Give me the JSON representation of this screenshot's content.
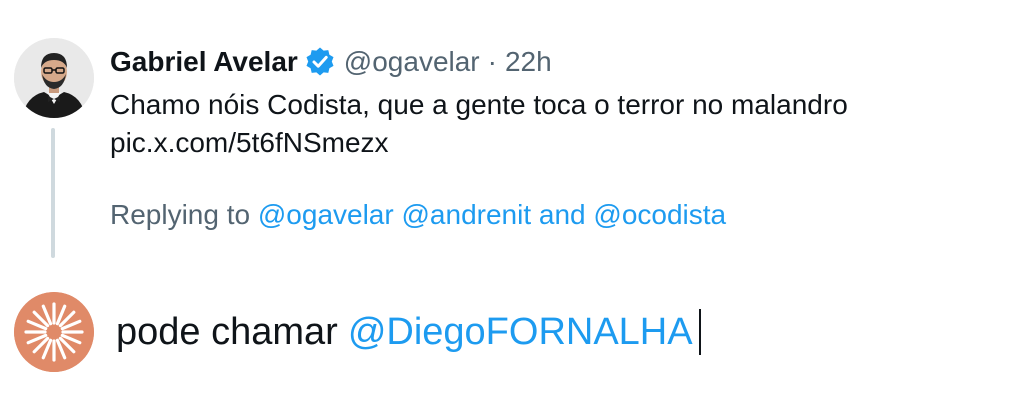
{
  "original_post": {
    "author_name": "Gabriel Avelar",
    "author_handle": "@ogavelar",
    "separator": "·",
    "time": "22h",
    "text_lines": [
      "Chamo nóis Codista, que a gente toca o terror no malandro",
      "pic.x.com/5t6fNSmezx"
    ],
    "replying_prefix": "Replying to",
    "replying_mention_1": "@ogavelar",
    "replying_mention_2": "@andrenit",
    "replying_and": "and",
    "replying_mention_3": "@ocodista",
    "avatar_icon": "profile-photo-man-suit-bowtie",
    "badge_icon": "verified-check-icon"
  },
  "composer": {
    "text_prefix": "pode chamar",
    "mention": "@DiegoFORNALHA",
    "avatar_icon": "starburst-logo-icon"
  },
  "colors": {
    "link": "#1d9bf0",
    "secondary_text": "#536471",
    "primary_text": "#0f1419",
    "thread_line": "#cfd9de",
    "composer_avatar_bg": "#e08a68"
  }
}
